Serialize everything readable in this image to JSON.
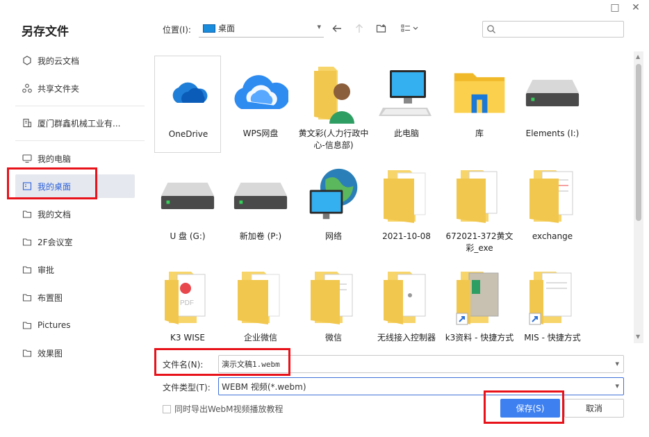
{
  "dialog": {
    "title": "另存文件",
    "restore_icon": "□",
    "close_icon": "✕"
  },
  "sidebar": {
    "items": [
      {
        "label": "我的云文档",
        "icon": "cloud-doc-icon"
      },
      {
        "label": "共享文件夹",
        "icon": "share-icon"
      },
      {
        "label": "厦门群鑫机械工业有...",
        "icon": "company-icon"
      },
      {
        "label": "我的电脑",
        "icon": "monitor-icon"
      },
      {
        "label": "我的桌面",
        "icon": "desktop-icon",
        "active": true
      },
      {
        "label": "我的文档",
        "icon": "folder-icon"
      },
      {
        "label": "2F会议室",
        "icon": "folder-icon"
      },
      {
        "label": "审批",
        "icon": "folder-icon"
      },
      {
        "label": "布置图",
        "icon": "folder-icon"
      },
      {
        "label": "Pictures",
        "icon": "folder-icon"
      },
      {
        "label": "效果图",
        "icon": "folder-icon"
      }
    ]
  },
  "toolbar": {
    "location_label": "位置(I):",
    "location_value": "桌面",
    "search_placeholder": ""
  },
  "files": [
    {
      "name": "OneDrive",
      "icon": "onedrive-icon"
    },
    {
      "name": "WPS网盘",
      "icon": "wps-cloud-icon"
    },
    {
      "name": "黄文彩(人力行政中心-信息部)",
      "icon": "user-folder-icon"
    },
    {
      "name": "此电脑",
      "icon": "computer-icon"
    },
    {
      "name": "库",
      "icon": "library-icon"
    },
    {
      "name": "Elements (I:)",
      "icon": "drive-icon"
    },
    {
      "name": "U 盘 (G:)",
      "icon": "drive-icon"
    },
    {
      "name": "新加卷 (P:)",
      "icon": "drive-icon"
    },
    {
      "name": "网络",
      "icon": "network-icon"
    },
    {
      "name": "2021-10-08",
      "icon": "folder-icon"
    },
    {
      "name": "672021-372黄文彩_exe",
      "icon": "folder-doc-icon"
    },
    {
      "name": "exchange",
      "icon": "folder-doc-icon"
    },
    {
      "name": "K3 WISE",
      "icon": "folder-pdf-icon"
    },
    {
      "name": "企业微信",
      "icon": "folder-icon"
    },
    {
      "name": "微信",
      "icon": "folder-doc-icon"
    },
    {
      "name": "无线接入控制器",
      "icon": "folder-doc-icon"
    },
    {
      "name": "k3资料 - 快捷方式",
      "icon": "folder-shortcut-icon"
    },
    {
      "name": "MIS - 快捷方式",
      "icon": "folder-shortcut-icon"
    }
  ],
  "form": {
    "filename_label": "文件名(N):",
    "filename_value": "演示文稿1.webm",
    "filetype_label": "文件类型(T):",
    "filetype_value": "WEBM 视频(*.webm)",
    "export_checkbox_label": "同时导出WebM视频播放教程",
    "save_label": "保存(S)",
    "cancel_label": "取消"
  },
  "colors": {
    "accent": "#3e80f0",
    "highlight": "#e8121a",
    "folder": "#f7d56a"
  }
}
